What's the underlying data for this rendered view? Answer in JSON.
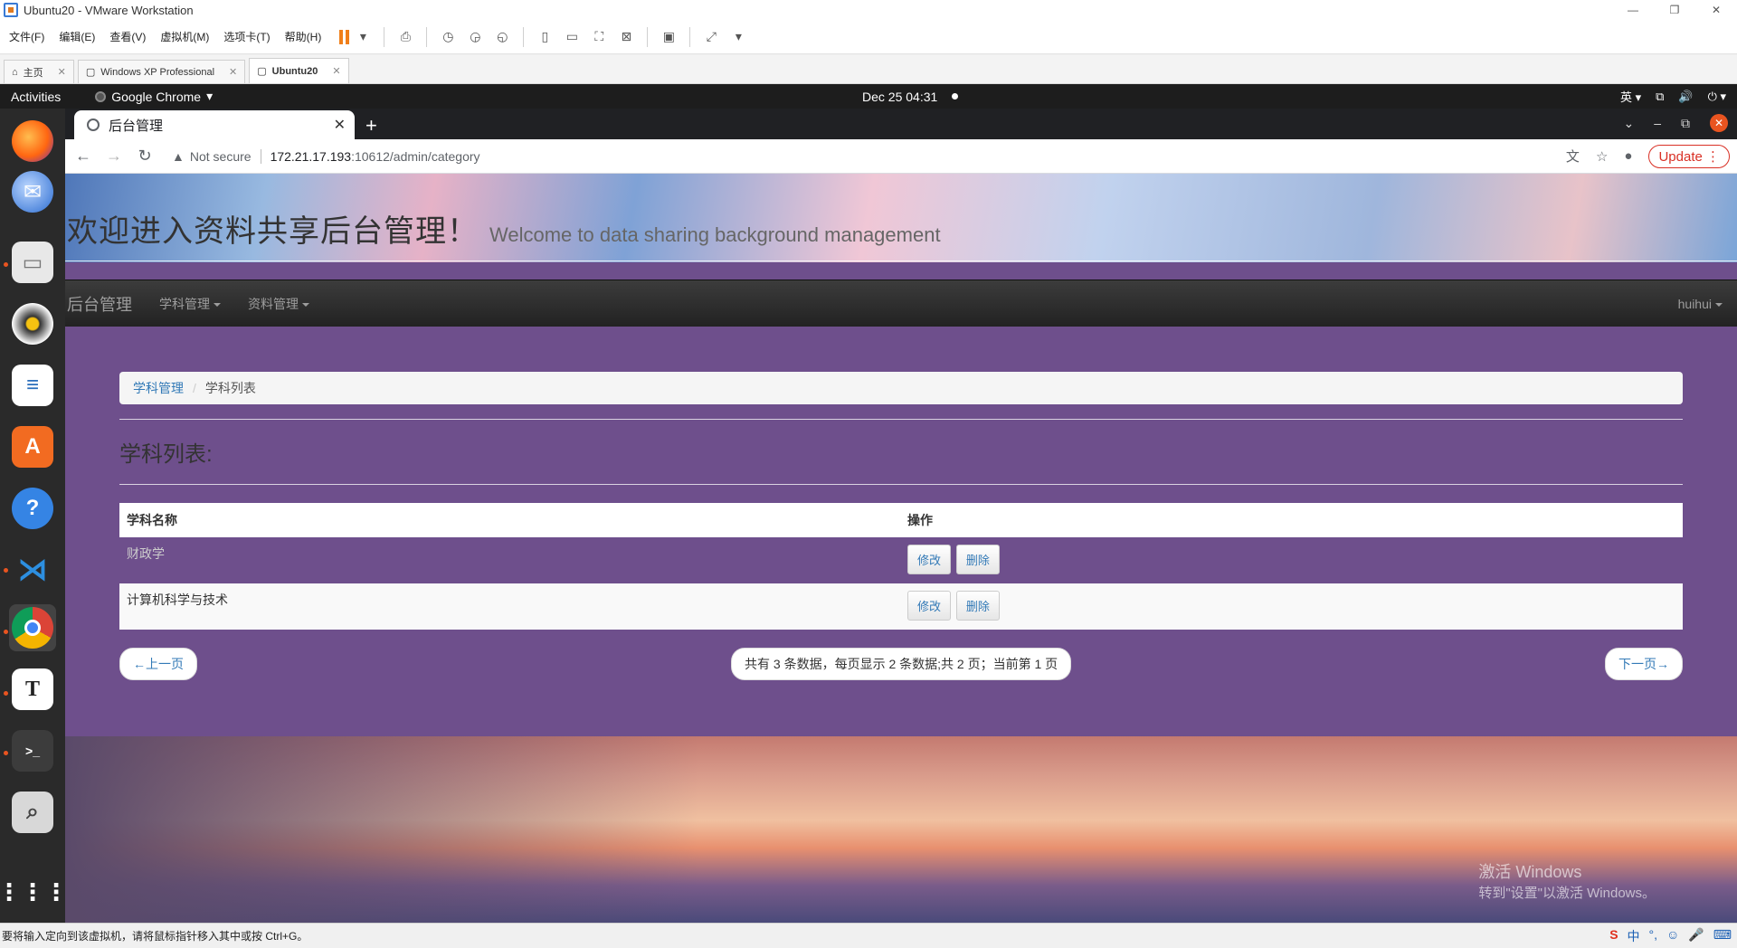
{
  "vmware": {
    "title": "Ubuntu20 - VMware Workstation",
    "menu": [
      "文件(F)",
      "编辑(E)",
      "查看(V)",
      "虚拟机(M)",
      "选项卡(T)",
      "帮助(H)"
    ],
    "tabs": [
      {
        "label": "主页"
      },
      {
        "label": "Windows XP Professional"
      },
      {
        "label": "Ubuntu20"
      }
    ],
    "status": "要将输入定向到该虚拟机，请将鼠标指针移入其中或按 Ctrl+G。",
    "ime": [
      "中",
      "°,",
      "☺",
      "🎤",
      "⌨"
    ]
  },
  "gnome": {
    "activities": "Activities",
    "app_name": "Google Chrome",
    "clock": "Dec 25  04:31",
    "input_method": "英"
  },
  "chrome": {
    "tab_title": "后台管理",
    "security": "Not secure",
    "url_host": "172.21.17.193",
    "url_path": ":10612/admin/category",
    "update_label": "Update"
  },
  "page": {
    "heading": "欢迎进入资料共享后台管理！",
    "subheading": "Welcome to data sharing background management",
    "nav": {
      "brand": "后台管理",
      "items": [
        "学科管理",
        "资料管理"
      ],
      "user": "huihui"
    },
    "breadcrumb": {
      "parent": "学科管理",
      "current": "学科列表"
    },
    "list_title": "学科列表:",
    "table": {
      "headers": [
        "学科名称",
        "操作"
      ],
      "rows": [
        {
          "name": "财政学",
          "edit": "修改",
          "delete": "删除"
        },
        {
          "name": "计算机科学与技术",
          "edit": "修改",
          "delete": "删除"
        }
      ]
    },
    "pager": {
      "prev": "←上一页",
      "summary": "共有 3 条数据，每页显示 2 条数据;共 2 页；当前第 1 页",
      "next": "下一页→"
    }
  },
  "watermark": {
    "line1": "激活 Windows",
    "line2": "转到\"设置\"以激活 Windows。"
  },
  "dock": [
    "firefox",
    "thunderbird",
    "files",
    "rhythmbox",
    "writer",
    "software",
    "help",
    "vscode",
    "chrome",
    "typora",
    "terminal",
    "screenshot",
    "apps-grid"
  ]
}
